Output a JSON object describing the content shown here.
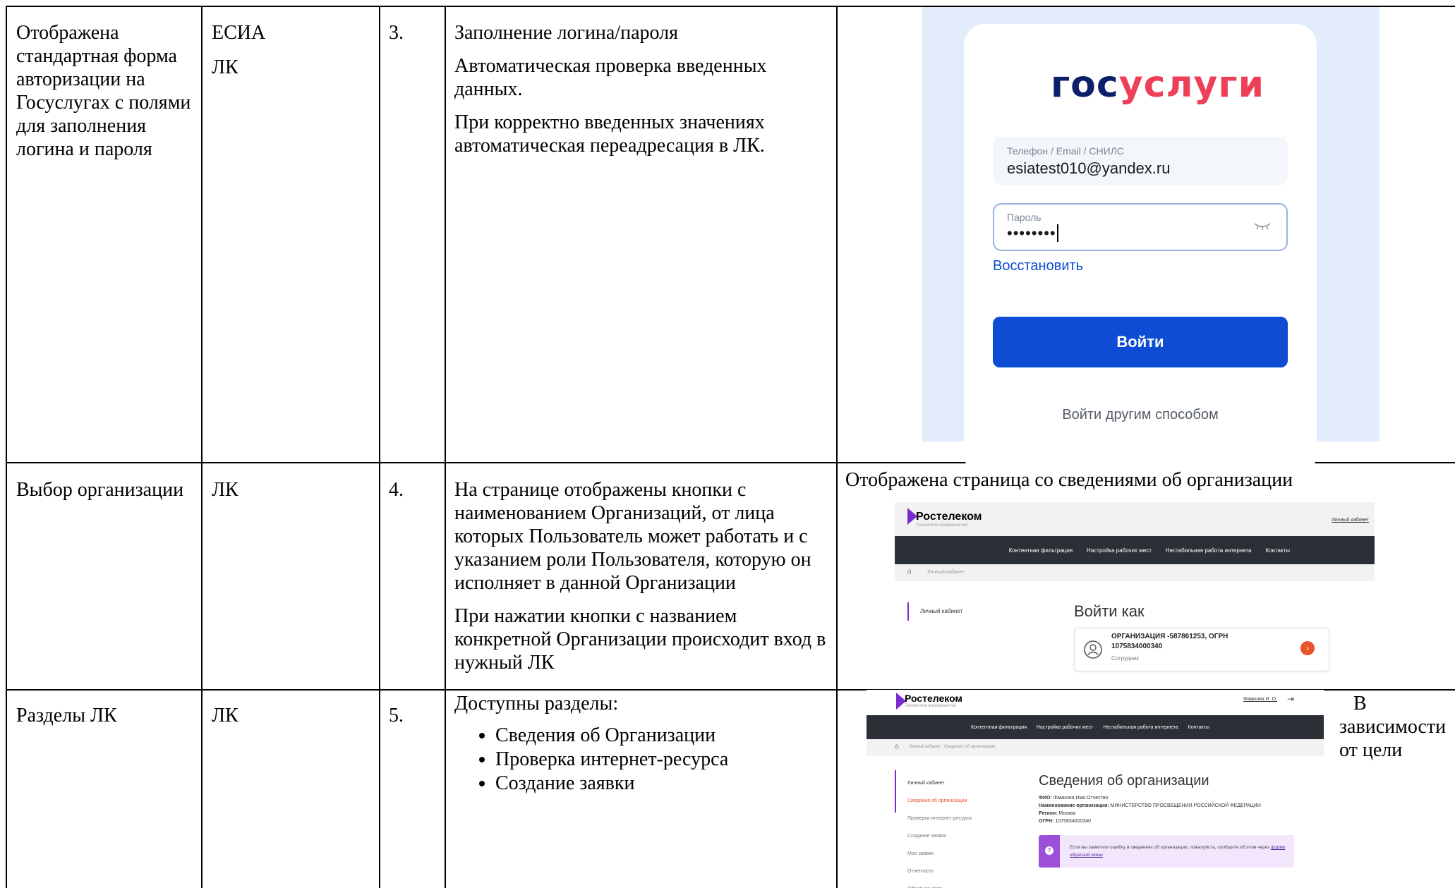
{
  "rows": [
    {
      "title": "Отображена стандартная форма авторизации на Госуслугах с полями для заполнения логина и пароля",
      "systems": [
        "ЕСИА",
        "ЛК"
      ],
      "number": "3.",
      "paragraphs": [
        "Заполнение логина/пароля",
        "Автоматическая проверка введенных данных.",
        "При корректно введенных значениях автоматическая переадресация в ЛК."
      ]
    },
    {
      "title": "Выбор организации",
      "systems": [
        "ЛК"
      ],
      "number": "4.",
      "paragraphs": [
        "На странице отображены кнопки с наименованием Организаций, от лица которых Пользователь может работать и с указанием роли Пользователя, которую он исполняет в данной Организации",
        "При нажатии кнопки с названием конкретной Организации происходит вход в нужный ЛК"
      ],
      "result_caption": "Отображена страница со сведениями об организации"
    },
    {
      "title": "Разделы ЛК",
      "systems": [
        "ЛК"
      ],
      "number": "5.",
      "intro": "Доступны разделы:",
      "bullets": [
        "Сведения об Организации",
        "Проверка интернет-ресурса",
        "Создание заявки"
      ],
      "note_lines": [
        "В",
        "зависимости",
        "от цели"
      ]
    }
  ],
  "gosuslugi": {
    "logo_dark": "гос",
    "logo_red": "услуги",
    "login_label": "Телефон / Email / СНИЛС",
    "login_value": "esiatest010@yandex.ru",
    "password_label": "Пароль",
    "password_value": "••••••••",
    "restore_link": "Восстановить",
    "submit_label": "Войти",
    "alt_login": "Войти другим способом",
    "colors": {
      "blue": "#0d4cd3",
      "red": "#ee3f58",
      "dark_blue": "#0b1f6b",
      "bg": "#e3ecfb"
    }
  },
  "rt_select": {
    "brand": "Ростелеком",
    "tagline": "Технологии возможностей",
    "account_link": "Личный кабинет",
    "nav": [
      "Контентная фильтрация",
      "Настройка рабочих мест",
      "Нестабильная работа интернета",
      "Контакты"
    ],
    "breadcrumb": "Личный кабинет",
    "sidebar_item": "Личный кабинет",
    "heading": "Войти как",
    "org_line1": "ОРГАНИЗАЦИЯ -587861253, ОГРН",
    "org_line2": "1075834000340",
    "org_role": "Сотрудник"
  },
  "rt_sections": {
    "brand": "Ростелеком",
    "tagline": "Технологии возможностей",
    "user": "Фамилия И. О.",
    "nav": [
      "Контентная фильтрация",
      "Настройка рабочих мест",
      "Нестабильная работа интернета",
      "Контакты"
    ],
    "breadcrumb": [
      "Личный кабинет",
      "Сведения об организации"
    ],
    "sidebar": [
      "Личный кабинет",
      "Сведения об организации",
      "Проверка интернет-ресурса",
      "Создание заявки",
      "Мои заявки",
      "Отчетность",
      "Обратная связь"
    ],
    "heading": "Сведения об организации",
    "fio_label": "ФИО:",
    "fio_value": "Фамилия Имя Отчество",
    "org_label": "Наименование организации:",
    "org_value": "МИНИСТЕРСТВО ПРОСВЕЩЕНИЯ РОССИЙСКОЙ ФЕДЕРАЦИИ",
    "region_label": "Регион:",
    "region_value": "Москва",
    "ogrn_label": "ОГРН:",
    "ogrn_value": "1075834000340",
    "notice_text": "Если вы заметили ошибку в сведениях об организации, пожалуйста, сообщите об этом через",
    "notice_link": "форму обратной связи",
    "accent": "#e8542a"
  }
}
